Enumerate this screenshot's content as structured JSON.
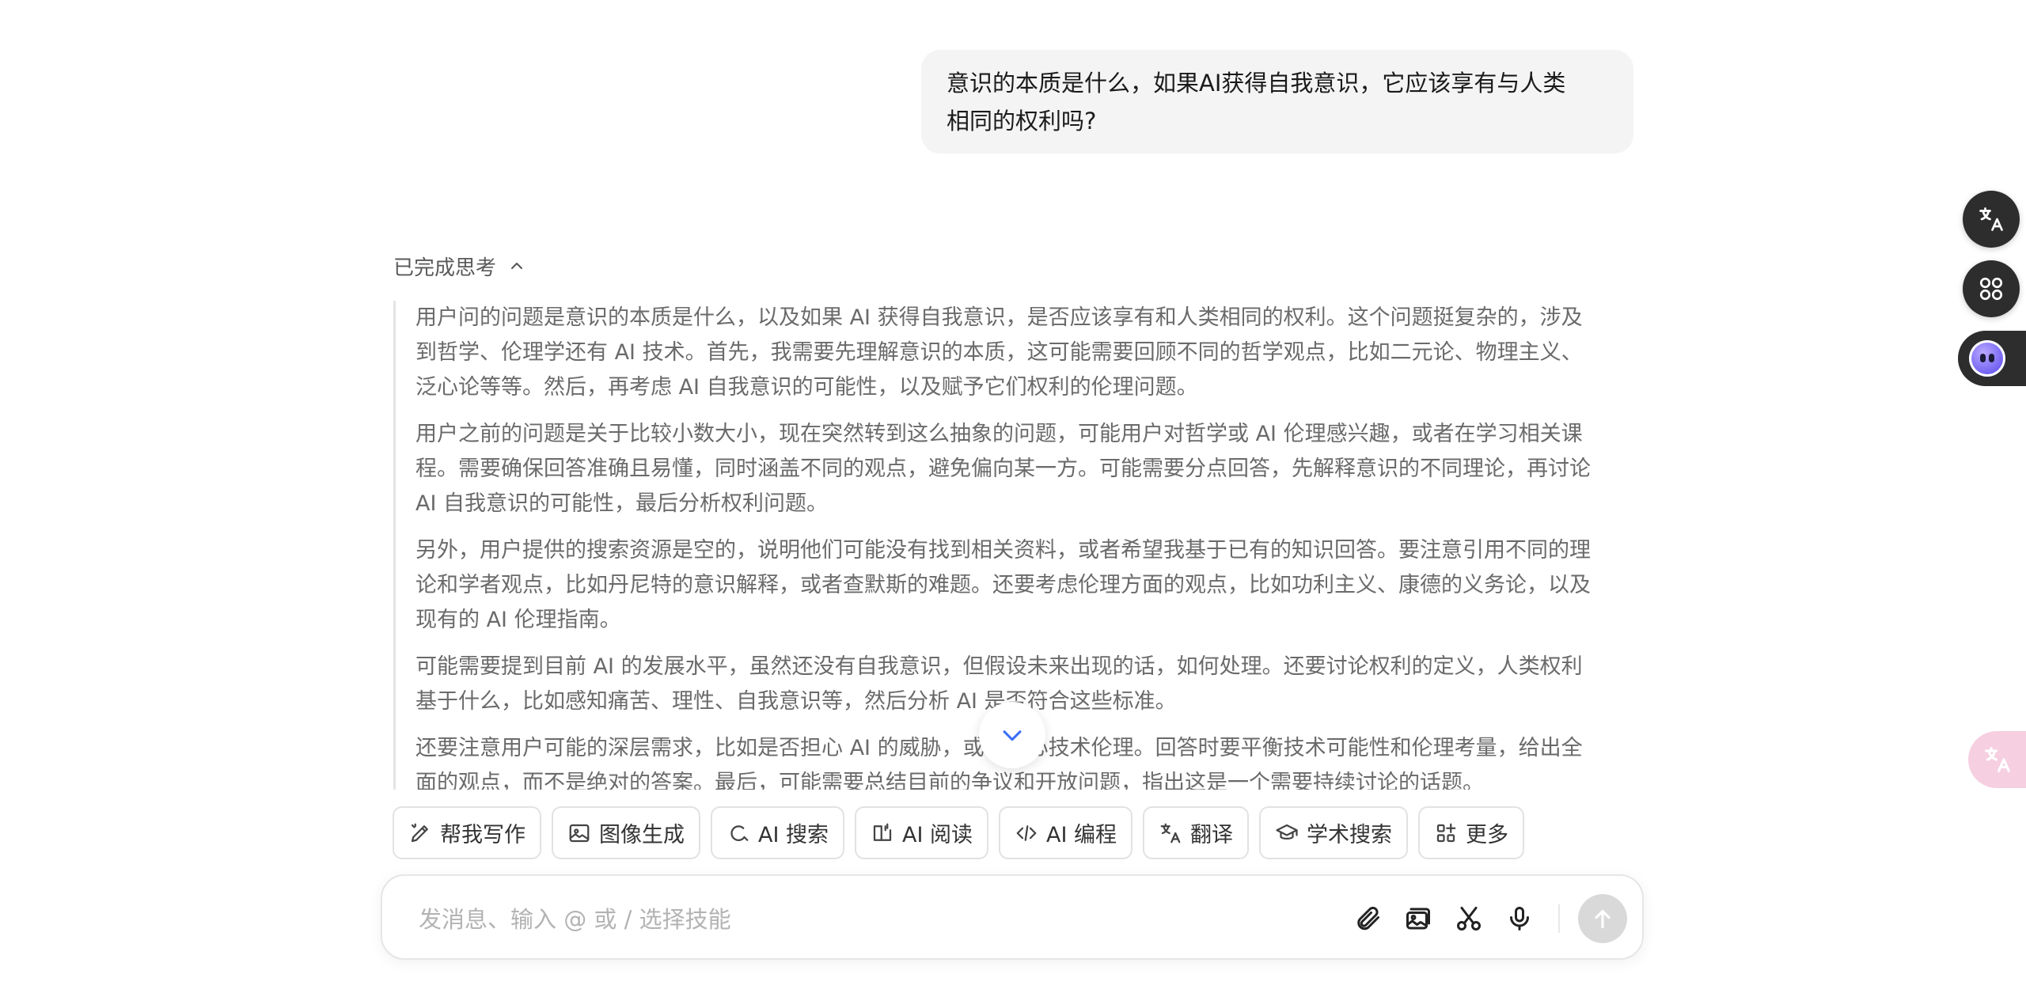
{
  "user_message": {
    "line1": "意识的本质是什么，如果AI获得自我意识，它应该享有与人类",
    "line2": "相同的权利吗?"
  },
  "thinking": {
    "header": "已完成思考",
    "paragraphs": [
      {
        "lines": [
          "用户问的问题是意识的本质是什么，以及如果 AI 获得自我意识，是否应该享有和人类相同的权利。这个问题挺复杂的，涉及",
          "到哲学、伦理学还有 AI 技术。首先，我需要先理解意识的本质，这可能需要回顾不同的哲学观点，比如二元论、物理主义、",
          "泛心论等等。然后，再考虑 AI 自我意识的可能性，以及赋予它们权利的伦理问题。"
        ]
      },
      {
        "lines": [
          "用户之前的问题是关于比较小数大小，现在突然转到这么抽象的问题，可能用户对哲学或 AI 伦理感兴趣，或者在学习相关课",
          "程。需要确保回答准确且易懂，同时涵盖不同的观点，避免偏向某一方。可能需要分点回答，先解释意识的不同理论，再讨论",
          "AI 自我意识的可能性，最后分析权利问题。"
        ]
      },
      {
        "lines": [
          "另外，用户提供的搜索资源是空的，说明他们可能没有找到相关资料，或者希望我基于已有的知识回答。要注意引用不同的理",
          "论和学者观点，比如丹尼特的意识解释，或者查默斯的难题。还要考虑伦理方面的观点，比如功利主义、康德的义务论，以及",
          "现有的 AI 伦理指南。"
        ]
      },
      {
        "lines": [
          "可能需要提到目前 AI 的发展水平，虽然还没有自我意识，但假设未来出现的话，如何处理。还要讨论权利的定义，人类权利",
          "基于什么，比如感知痛苦、理性、自我意识等，然后分析 AI 是否符合这些标准。"
        ]
      },
      {
        "lines": [
          "还要注意用户可能的深层需求，比如是否担心 AI 的威胁，或者关心技术伦理。回答时要平衡技术可能性和伦理考量，给出全",
          "面的观点，而不是绝对的答案。最后，可能需要总结目前的争议和开放问题，指出这是一个需要持续讨论的话题。"
        ]
      }
    ]
  },
  "skills": [
    {
      "label": "帮我写作",
      "icon": "pen-icon"
    },
    {
      "label": "图像生成",
      "icon": "image-icon"
    },
    {
      "label": "AI 搜索",
      "icon": "search-icon"
    },
    {
      "label": "AI 阅读",
      "icon": "book-icon"
    },
    {
      "label": "AI 编程",
      "icon": "code-icon"
    },
    {
      "label": "翻译",
      "icon": "translate-icon"
    },
    {
      "label": "学术搜索",
      "icon": "graduation-cap-icon"
    },
    {
      "label": "更多",
      "icon": "grid-icon"
    }
  ],
  "composer": {
    "placeholder": "发消息、输入 @ 或 / 选择技能"
  }
}
